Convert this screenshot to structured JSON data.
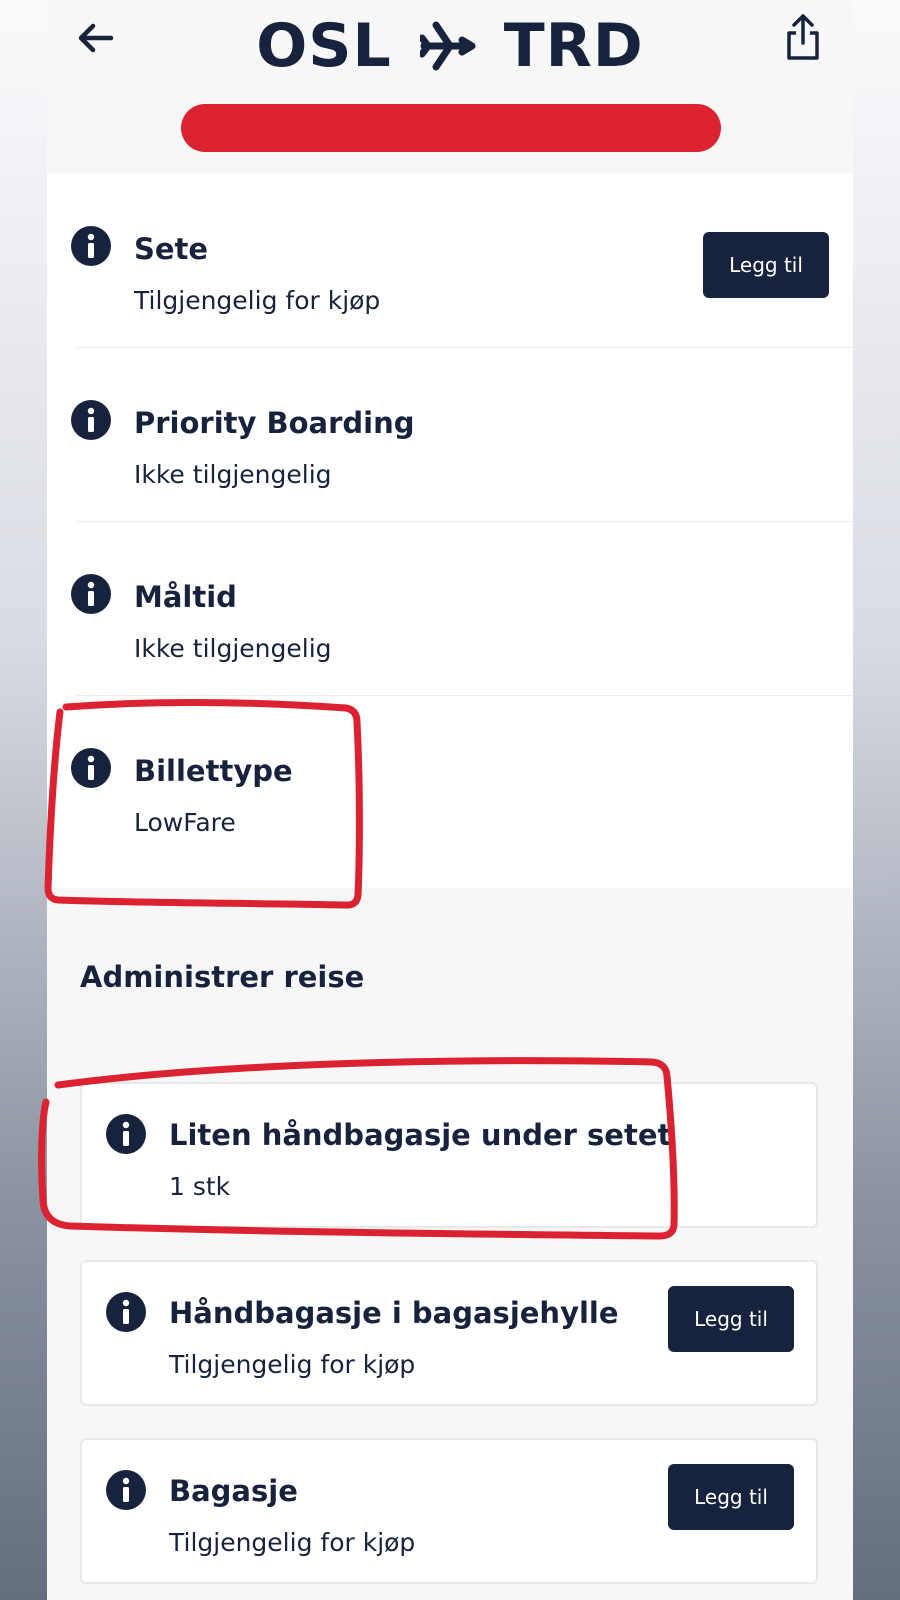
{
  "header": {
    "origin": "OSL",
    "destination": "TRD",
    "redaction_color": "#db2230"
  },
  "icons": {
    "back": "arrow-left-icon",
    "share": "share-icon",
    "plane": "airplane-icon",
    "info": "info-icon"
  },
  "colors": {
    "primary": "#17233d",
    "annotation": "#db2230"
  },
  "services": [
    {
      "title": "Sete",
      "status": "Tilgjengelig for kjøp",
      "button": "Legg til"
    },
    {
      "title": "Priority Boarding",
      "status": "Ikke tilgjengelig"
    },
    {
      "title": "Måltid",
      "status": "Ikke tilgjengelig"
    },
    {
      "title": "Billettype",
      "status": "LowFare"
    }
  ],
  "manage": {
    "title": "Administrer reise",
    "items": [
      {
        "title": "Liten håndbagasje under setet",
        "status": "1 stk"
      },
      {
        "title": "Håndbagasje i bagasjehylle",
        "status": "Tilgjengelig for kjøp",
        "button": "Legg til"
      },
      {
        "title": "Bagasje",
        "status": "Tilgjengelig for kjøp",
        "button": "Legg til"
      }
    ]
  }
}
